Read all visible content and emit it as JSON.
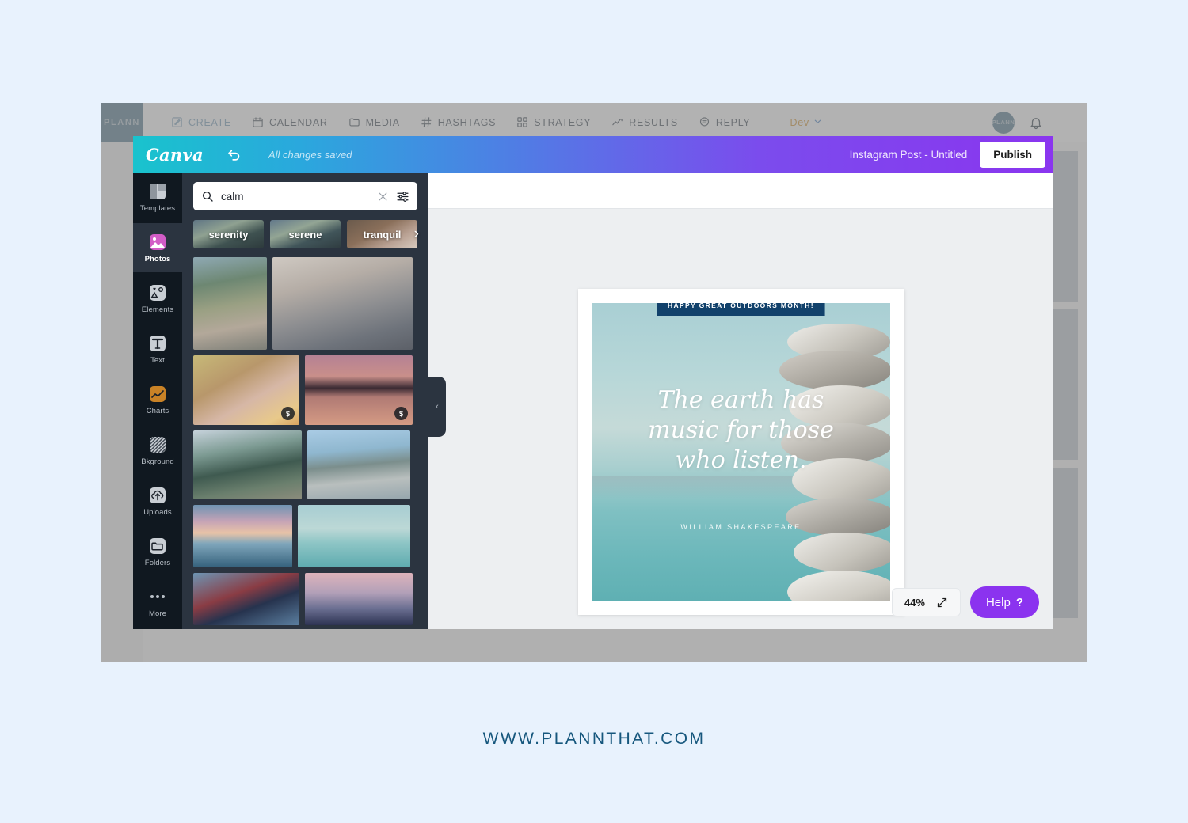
{
  "plann": {
    "logo": "PLANN",
    "nav": [
      {
        "label": "CREATE",
        "icon": "pencil-square-icon",
        "active": true
      },
      {
        "label": "CALENDAR",
        "icon": "calendar-icon",
        "active": false
      },
      {
        "label": "MEDIA",
        "icon": "folder-icon",
        "active": false
      },
      {
        "label": "HASHTAGS",
        "icon": "hash-icon",
        "active": false
      },
      {
        "label": "STRATEGY",
        "icon": "grid-icon",
        "active": false
      },
      {
        "label": "RESULTS",
        "icon": "trend-line-icon",
        "active": false
      },
      {
        "label": "REPLY",
        "icon": "chat-bubble-icon",
        "active": false
      }
    ],
    "env_label": "Dev",
    "avatar_label": "PLANN",
    "close_label": "×"
  },
  "canva": {
    "logo": "Canva",
    "undo_icon": "undo-arrow-icon",
    "save_status": "All changes saved",
    "doc_title": "Instagram Post - Untitled",
    "publish_label": "Publish",
    "header_gradient_start": "#19c3cd",
    "header_gradient_end": "#8a35ef",
    "rail": [
      {
        "label": "Templates",
        "icon": "templates-icon",
        "selected": false
      },
      {
        "label": "Photos",
        "icon": "photos-icon",
        "selected": true
      },
      {
        "label": "Elements",
        "icon": "elements-icon",
        "selected": false
      },
      {
        "label": "Text",
        "icon": "text-icon",
        "selected": false
      },
      {
        "label": "Charts",
        "icon": "charts-icon",
        "selected": false
      },
      {
        "label": "Bkground",
        "icon": "background-icon",
        "selected": false
      },
      {
        "label": "Uploads",
        "icon": "uploads-icon",
        "selected": false
      },
      {
        "label": "Folders",
        "icon": "folders-icon",
        "selected": false
      },
      {
        "label": "More",
        "icon": "more-dots-icon",
        "selected": false
      }
    ],
    "search": {
      "value": "calm",
      "placeholder": "Search",
      "search_icon": "search-icon",
      "clear_icon": "close-icon",
      "filter_icon": "sliders-icon"
    },
    "keywords": [
      "serenity",
      "serene",
      "tranquil"
    ],
    "keywords_next_icon": "chevron-right-icon",
    "collapse_icon": "chevron-left-icon",
    "photos": [
      {
        "name": "woman-kayak-lake",
        "premium": false
      },
      {
        "name": "office-meeting-team",
        "premium": false
      },
      {
        "name": "boy-writing-classroom",
        "premium": true
      },
      {
        "name": "sunset-mountain-lake",
        "premium": true
      },
      {
        "name": "person-dock-mountain-lake",
        "premium": false
      },
      {
        "name": "person-pier-blue-lake",
        "premium": false
      },
      {
        "name": "ocean-sunset-pastel",
        "premium": false
      },
      {
        "name": "stacked-stones-sea",
        "premium": false
      },
      {
        "name": "man-suit-meditating-chair",
        "premium": false
      },
      {
        "name": "pink-mountain-layers",
        "premium": false
      }
    ],
    "design": {
      "banner": "HAPPY GREAT OUTDOORS MONTH!",
      "banner_color": "#11416b",
      "quote_line1": "The earth has",
      "quote_line2": "music for those",
      "quote_line3": "who listen.",
      "author": "WILLIAM SHAKESPEARE"
    },
    "zoom": {
      "value": "44%",
      "expand_icon": "expand-arrows-icon"
    },
    "help": {
      "label": "Help",
      "mark": "?",
      "color": "#8b33ef"
    }
  },
  "footer": {
    "url": "WWW.PLANNTHAT.COM"
  }
}
